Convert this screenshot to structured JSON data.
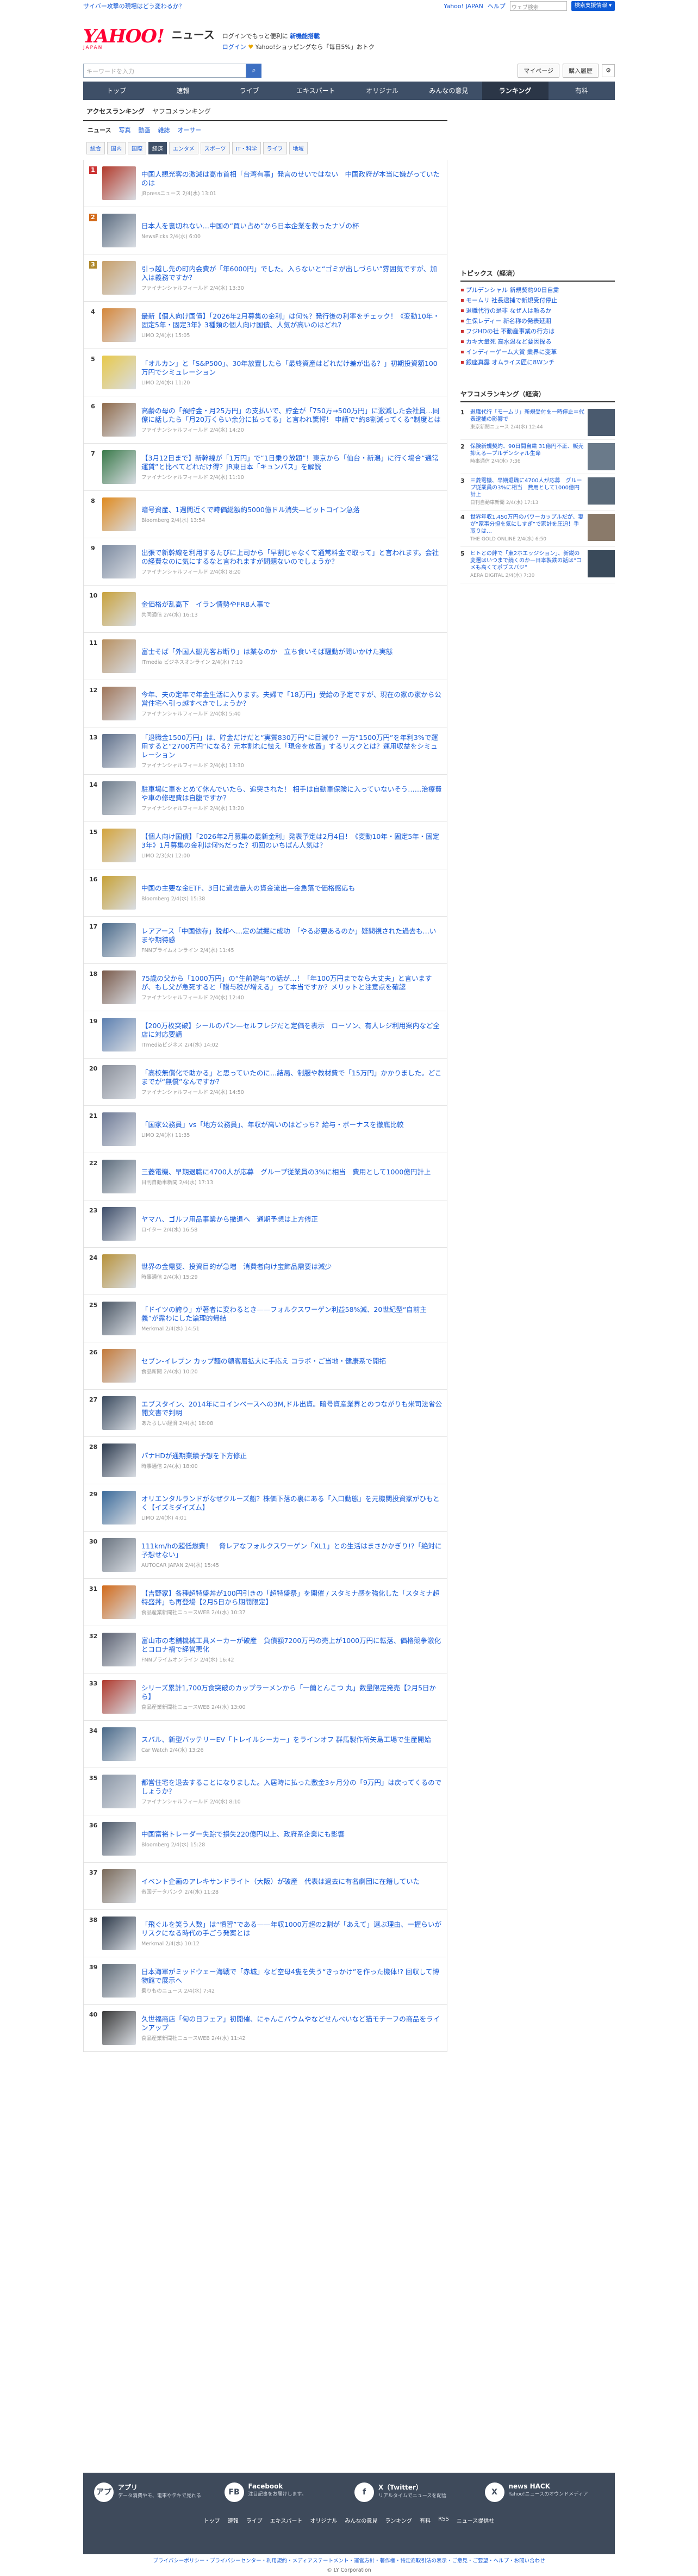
{
  "util": {
    "notice": "サイバー攻撃の現場はどう変わるか？",
    "yahoo_japan": "Yahoo! JAPAN",
    "help": "ヘルプ",
    "search_placeholder": "ウェブ検索",
    "search_button": "検索支援情報 ▾"
  },
  "header": {
    "logo": "YAHOO!",
    "logo_sub": "JAPAN",
    "service": "ニュース",
    "promo_line1_a": "ログインでもっと便利に",
    "promo_line1_b": "新機能搭載",
    "promo_line2_login": "ログイン",
    "promo_line2": "Yahoo!ショッピングなら「毎日5%」おトク"
  },
  "search": {
    "placeholder": "キーワードを入力",
    "mypage": "マイページ",
    "purchase": "購入履歴"
  },
  "gnav": [
    "トップ",
    "速報",
    "ライブ",
    "エキスパート",
    "オリジナル",
    "みんなの意見",
    "ランキング",
    "有料"
  ],
  "gnav_active": "ランキング",
  "subtabs": {
    "active": "アクセスランキング",
    "other": "ヤフコメランキング"
  },
  "cat1": [
    {
      "label": "ニュース",
      "active": true
    },
    {
      "label": "写真",
      "active": false
    },
    {
      "label": "動画",
      "active": false
    },
    {
      "label": "雑誌",
      "active": false
    },
    {
      "label": "オーサー",
      "active": false
    }
  ],
  "cat2": [
    {
      "label": "総合",
      "active": false
    },
    {
      "label": "国内",
      "active": false
    },
    {
      "label": "国際",
      "active": false
    },
    {
      "label": "経済",
      "active": true
    },
    {
      "label": "エンタメ",
      "active": false
    },
    {
      "label": "スポーツ",
      "active": false
    },
    {
      "label": "IT・科学",
      "active": false
    },
    {
      "label": "ライフ",
      "active": false
    },
    {
      "label": "地域",
      "active": false
    }
  ],
  "ranking": [
    {
      "rank": "1",
      "title": "中国人観光客の激減は高市首相「台湾有事」発言のせいではない　中国政府が本当に嫌がっていたのは",
      "source": "JBpressニュース  2/4(水) 13:01",
      "thumb": "#b33a2b"
    },
    {
      "rank": "2",
      "title": "日本人を裏切れない…中国の“買い占め”から日本企業を救ったナゾの杯",
      "source": "NewsPicks  2/4(水) 6:00",
      "thumb": "#5b6c80"
    },
    {
      "rank": "3",
      "title": "引っ越し先の町内会費が「年6000円」でした。入らないと“ゴミが出しづらい”雰囲気ですが、加入は義務ですか？",
      "source": "ファイナンシャルフィールド  2/4(水) 13:30",
      "thumb": "#c8a06a"
    },
    {
      "rank": "4",
      "title": "最新【個人向け国債】「2026年2月募集の金利」は何%？発行後の利率をチェック！《変動10年・固定5年・固定3年》3種類の個人向け国債、人気が高いのはどれ？",
      "source": "LIMO  2/4(水) 15:05",
      "thumb": "#d6873a"
    },
    {
      "rank": "5",
      "title": "「オルカン」と「S&P500」、30年放置したら「最終資産はどれだけ差が出る？」初期投資額100万円でシミュレーション",
      "source": "LIMO  2/4(水) 11:20",
      "thumb": "#e8c94a"
    },
    {
      "rank": "6",
      "title": "高齢の母の「預貯金・月25万円」の支払いで、貯金が「750万→500万円」に激減した会社員…同僚に話したら「月20万くらい余分に払ってる」と言われ驚愕！ 申請で“約8割減ってくる”制度とは",
      "source": "ファイナンシャルフィールド  2/4(水) 14:20",
      "thumb": "#8f6a4a"
    },
    {
      "rank": "7",
      "title": "【3月12日まで】新幹線が「1万円」で“1日乗り放題”！東京から「仙台・新潟」に行く場合“通常運賃”と比べてどれだけ得？JR東日本「キュンパス」を解説",
      "source": "ファイナンシャルフィールド  2/4(水) 11:10",
      "thumb": "#3a7a4a"
    },
    {
      "rank": "8",
      "title": "暗号資産、1週間近くで時価総額約5000億ドル消失—ビットコイン急落",
      "source": "Bloomberg  2/4(水) 13:54",
      "thumb": "#e08a1e"
    },
    {
      "rank": "9",
      "title": "出張で新幹線を利用するたびに上司から「早割じゃなくて通常料金で取って」と言われます。会社の経費なのに気にするなと言われますが問題ないのでしょうか？",
      "source": "ファイナンシャルフィールド  2/4(水) 8:20",
      "thumb": "#7c8aa0"
    },
    {
      "rank": "10",
      "title": "金価格が乱高下　イラン情勢やFRB人事で",
      "source": "共同通信  2/4(水) 16:13",
      "thumb": "#c9a23c"
    },
    {
      "rank": "11",
      "title": "富士そば「外国人観光客お断り」は業なのか　立ち食いそば騒動が問いかけた実態",
      "source": "ITmedia ビジネスオンライン  2/4(水) 7:10",
      "thumb": "#b89060"
    },
    {
      "rank": "12",
      "title": "今年、夫の定年で年金生活に入ります。夫婦で「18万円」受給の予定ですが、現在の家の家から公営住宅へ引っ越すべきでしょうか？",
      "source": "ファイナンシャルフィールド  2/4(水) 5:40",
      "thumb": "#a0765a"
    },
    {
      "rank": "13",
      "title": "「退職金1500万円」は、貯金だけだと“実質830万円”に目減り？一方“1500万円”を年利3%で運用すると“2700万円”になる？元本割れに怯え「現金を放置」するリスクとは？運用収益をシミュレーション",
      "source": "ファイナンシャルフィールド  2/4(水) 13:30",
      "thumb": "#5e6f8a"
    },
    {
      "rank": "14",
      "title": "駐車場に車をとめて休んでいたら、追突された！ 相手は自動車保険に入っていないそう……治療費や車の修理費は自腹ですか？",
      "source": "ファイナンシャルフィールド  2/4(水) 13:20",
      "thumb": "#6f7d8c"
    },
    {
      "rank": "15",
      "title": "【個人向け国債】「2026年2月募集の最新金利」発表予定は2月4日！《変動10年・固定5年・固定3年》1月募集の金利は何%だった？初回のいちばん人気は？",
      "source": "LIMO  2/3(火) 12:00",
      "thumb": "#d4a43c"
    },
    {
      "rank": "16",
      "title": "中国の主要な金ETF、3日に過去最大の資金流出—金急落で価格感応も",
      "source": "Bloomberg  2/4(水) 15:38",
      "thumb": "#c8a236"
    },
    {
      "rank": "17",
      "title": "レアアース「中国依存」脱却へ…定の試掘に成功　「やる必要あるのか」疑問視された過去も…いまや期待感",
      "source": "FNNプライムオンライン  2/4(水) 11:45",
      "thumb": "#4a6a8a"
    },
    {
      "rank": "18",
      "title": "75歳の父から「1000万円」の“生前贈与”の話が…！「年100万円までなら大丈夫」と言いますが、もし父が急死すると「贈与税が増える」って本当ですか？メリットと注意点を確認",
      "source": "ファイナンシャルフィールド  2/4(水) 12:40",
      "thumb": "#7a5a4a"
    },
    {
      "rank": "19",
      "title": "【200万枚突破】シールのパン—セルフレジだと定価を表示　ローソン、有人レジ利用案内など全店に対応要請",
      "source": "ITmediaビジネス  2/4(水) 14:02",
      "thumb": "#5c7fb0"
    },
    {
      "rank": "20",
      "title": "「高校無償化で助かる」と思っていたのに…結局、制服や教材費で「15万円」かかりました。どこまでが“無償”なんですか？",
      "source": "ファイナンシャルフィールド  2/4(水) 14:50",
      "thumb": "#8a8f9a"
    },
    {
      "rank": "21",
      "title": "「国家公務員」vs「地方公務員」、年収が高いのはどっち？給与・ボーナスを徹底比較",
      "source": "LIMO  2/4(水) 11:35",
      "thumb": "#6e7a96"
    },
    {
      "rank": "22",
      "title": "三菱電機、早期退職に4700人が応募　グループ従業員の3%に相当　費用として1000億円計上",
      "source": "日刊自動車新聞  2/4(水) 17:13",
      "thumb": "#5a6a7a"
    },
    {
      "rank": "23",
      "title": "ヤマハ、ゴルフ用品事業から撤退へ　通期予想は上方修正",
      "source": "ロイター  2/4(水) 16:58",
      "thumb": "#3e4e6a"
    },
    {
      "rank": "24",
      "title": "世界の金需要、投資目的が急増　消費者向け宝飾品需要は減少",
      "source": "時事通信  2/4(水) 15:29",
      "thumb": "#b8923a"
    },
    {
      "rank": "25",
      "title": "「ドイツの誇り」が著者に変わるとき——フォルクスワーゲン利益58%減、20世紀型“自前主義”が露わにした論理的帰結",
      "source": "Merkmal  2/4(水) 14:51",
      "thumb": "#4a5664"
    },
    {
      "rank": "26",
      "title": "セブン-イレブン カップ麺の顧客層拡大に手応え コラボ・ご当地・健康系で開拓",
      "source": "食品新聞  2/4(水) 10:20",
      "thumb": "#c47a3a"
    },
    {
      "rank": "27",
      "title": "エブスタイン、2014年にコインベースへの3M,ドル出資。暗号資産業界とのつながりも米司法省公開文書で判明",
      "source": "あたらしい経済  2/4(水) 18:08",
      "thumb": "#3a4a5e"
    },
    {
      "rank": "28",
      "title": "パナHDが通期業績予想を下方修正",
      "source": "時事通信  2/4(水) 18:00",
      "thumb": "#2c3a4e"
    },
    {
      "rank": "29",
      "title": "オリエンタルランドがなぜクルーズ船？株価下落の裏にある「入口動態」を元機関投資家がひもとく【イズミダイズム】",
      "source": "LIMO  2/4(水) 4:01",
      "thumb": "#3a6a9a"
    },
    {
      "rank": "30",
      "title": "111km/hの超低燃費！　脅レアなフォルクスワーゲン「XL1」との生活はまさかかぎり!?「絶対に予想せない」",
      "source": "AUTOCAR JAPAN  2/4(水) 15:45",
      "thumb": "#6a7480"
    },
    {
      "rank": "31",
      "title": "【吉野家】各種超特盛丼が100円引きの「超特盛祭」を開催 / スタミナ感を強化した「スタミナ超特盛丼」も再登場【2月5日から期間限定】",
      "source": "食品産業新聞社ニュースWEB  2/4(水) 10:37",
      "thumb": "#d26a1a"
    },
    {
      "rank": "32",
      "title": "富山市の老舗機械工具メーカーが破産　負債額7200万円の売上が1000万円に転落、価格競争激化とコロナ禍で経営悪化",
      "source": "FNNプライムオンライン  2/4(水) 16:42",
      "thumb": "#5a6070"
    },
    {
      "rank": "33",
      "title": "シリーズ累計1,700万食突破のカップラーメンから「一蘭とんこつ 丸」数量限定発売【2月5日から】",
      "source": "食品産業新聞社ニュースWEB  2/4(水) 13:00",
      "thumb": "#b03a2e"
    },
    {
      "rank": "34",
      "title": "スバル、新型バッテリーEV「トレイルシーカー」をラインオフ 群馬製作所矢島工場で生産開始",
      "source": "Car Watch  2/4(水) 13:26",
      "thumb": "#4a6a8a"
    },
    {
      "rank": "35",
      "title": "都営住宅を退去することになりました。入居時に払った敷金3ヶ月分の「9万円」は戻ってくるのでしょうか？",
      "source": "ファイナンシャルフィールド  2/4(水) 8:10",
      "thumb": "#8a96a6"
    },
    {
      "rank": "36",
      "title": "中国富裕トレーダー失踪で損失220億円以上、政府系企業にも影響",
      "source": "Bloomberg  2/4(水) 15:28",
      "thumb": "#4e5a6a"
    },
    {
      "rank": "37",
      "title": "イベント企画のアレキサンドライト（大阪）が破産　代表は過去に有名劇団に在籍していた",
      "source": "帝国データバンク  2/4(水) 11:28",
      "thumb": "#7a6a5a"
    },
    {
      "rank": "38",
      "title": "「飛ぐルを笑う人数」は“慎習”である——年収1000万超の2割が「あえて」選ぶ理由、一握らいがリスクになる時代の手ごう発案とは",
      "source": "Merkmal  2/4(水) 10:12",
      "thumb": "#2e3a4a"
    },
    {
      "rank": "39",
      "title": "日本海軍がミッドウェー海戦で「赤城」など空母4隻を失う“きっかけ”を作った機体!? 回収して博物館で展示へ",
      "source": "乗りものニュース  2/4(水) 7:42",
      "thumb": "#5e6a76"
    },
    {
      "rank": "40",
      "title": "久世福商店「旬の日フェア」初開催、にゃんこバウムやなどせんべいなど猫モチーフの商品をラインアップ",
      "source": "食品産業新聞社ニュースWEB  2/4(水) 11:42",
      "thumb": "#3a3a3a"
    }
  ],
  "side": {
    "topics_head": "トピックス（経済）",
    "topics": [
      "プルデンシャル 新規契約90日自粛",
      "モームリ 社長逮捕で新規受付停止",
      "退職代行の是非 なぜ人は頼るか",
      "生保レディー 新名称の発表延期",
      "フジHDの社 不動産事業の行方は",
      "カキ大量死 高水温など要因探る",
      "インディーゲーム大賞 業界に変革",
      "銀座真露 オムライス匠に8Wンチ"
    ],
    "comment_head": "ヤフコメランキング（経済）",
    "comment_ranks": [
      {
        "n": "1",
        "t": "退職代行「モームリ」新規受付を一時停止＝代表逮捕の影響で",
        "s": "東京新聞ニュース  2/4(水) 12:44"
      },
      {
        "n": "2",
        "t": "保険新規契約、90日間自粛 31億円不正、販売抑える—プルデンシャル生命",
        "s": "時事通信  2/4(水) 7:36"
      },
      {
        "n": "3",
        "t": "三菱電機、早期退職に4700人が応募　グループ従業員の3%に相当　費用として1000億円計上",
        "s": "日刊自動車新聞  2/4(水) 17:13"
      },
      {
        "n": "4",
        "t": "世界年収1,450万円のパワーカップルだが、妻が“家事分担を気にしすぎ”で家計を圧迫！手取りは…",
        "s": "THE GOLD ONLINE  2/4(水) 6:50"
      },
      {
        "n": "5",
        "t": "ヒトとの絆で「東2ホエッジション」、新鋭の変遷はいつまで続くのか—日本製鉄の話は“コメも高くてポブスバジ”",
        "s": "AERA DIGITAL  2/4(水) 7:30"
      }
    ]
  },
  "footer": {
    "cols": [
      {
        "icon": "アプリ",
        "title": "アプリ",
        "desc": "データ消費やモ、電車やテキで見れる"
      },
      {
        "icon": "FB",
        "title": "Facebook",
        "desc": "注目記事をお届けします。"
      },
      {
        "icon": "f",
        "title": "X（Twitter）",
        "desc": "リアルタイムでニュースを配信"
      },
      {
        "icon": "X",
        "title": "news HACK",
        "desc": "Yahoo!ニュースのオウンドメディア"
      }
    ],
    "links": [
      "トップ",
      "速報",
      "ライブ",
      "エキスパート",
      "オリジナル",
      "みんなの意見",
      "ランキング",
      "有料",
      "RSS",
      "ニュース提供社"
    ],
    "legal": "プライバシーポリシー・プライバシーセンター・利用規約・メディアステートメント・運営方針・著作権・特定商取引法の表示・ご意見・ご要望・ヘルプ・お問い合わせ",
    "copyright": "© LY Corporation"
  }
}
